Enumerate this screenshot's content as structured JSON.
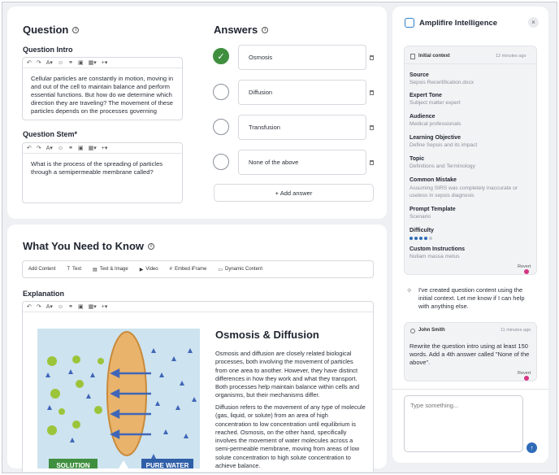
{
  "question": {
    "title": "Question",
    "intro_label": "Question Intro",
    "intro_text": "Cellular particles are constantly in motion, moving in and out of the cell to maintain balance and perform essential functions. But how do we determine which direction they are traveling? The movement of these particles depends on the processes governing",
    "stem_label": "Question Stem*",
    "stem_text": "What is the process of the spreading of particles through a semipermeable membrane called?"
  },
  "answers": {
    "title": "Answers",
    "items": [
      {
        "label": "Osmosis",
        "correct": true
      },
      {
        "label": "Diffusion",
        "correct": false
      },
      {
        "label": "Transfusion",
        "correct": false
      },
      {
        "label": "None of the above",
        "correct": false
      }
    ],
    "add_label": "+ Add answer"
  },
  "wytk": {
    "title": "What You Need to Know",
    "toolbar": [
      "Add Content",
      "Text",
      "Text & Image",
      "Video",
      "Embed iFrame",
      "Dynamic Content"
    ],
    "explanation_label": "Explanation",
    "heading": "Osmosis & Diffusion",
    "p1": "Osmosis and diffusion are closely related biological processes, both involving the movement of particles from one area to another. However, they have distinct differences in how they work and what they transport. Both processes help maintain balance within cells and organisms, but their mechanisms differ.",
    "p2": "Diffusion refers to the movement of any type of molecule (gas, liquid, or solute) from an area of high concentration to low concentration until equilibrium is reached. Osmosis, on the other hand, specifically involves the movement of water molecules across a semi-permeable membrane, moving from areas of low solute concentration to high solute concentration to achieve balance.",
    "img_left_label": "SOLUTION",
    "img_right_label": "PURE WATER"
  },
  "ai": {
    "title": "Amplifire Intelligence",
    "context_label": "Initial context",
    "context_time": "12 minutes ago",
    "fields": [
      {
        "k": "Source",
        "v": "Sepsis Recertification.docx"
      },
      {
        "k": "Expert Tone",
        "v": "Subject matter expert"
      },
      {
        "k": "Audience",
        "v": "Medical professionals"
      },
      {
        "k": "Learning Objective",
        "v": "Define Sepsis and its impact"
      },
      {
        "k": "Topic",
        "v": "Definitions and Terminology"
      },
      {
        "k": "Common Mistake",
        "v": "Assuming SIRS was completely inaccurate or useless in sepsis diagnosis"
      },
      {
        "k": "Prompt Template",
        "v": "Scenario"
      },
      {
        "k": "Difficulty",
        "v": ""
      },
      {
        "k": "Custom Instructions",
        "v": "Nullam massa metus"
      }
    ],
    "difficulty_level": 4,
    "revert_label": "Revert",
    "assistant_msg": "I've created question content using the initial context. Let me know if I can help with anything else.",
    "user_name": "John Smith",
    "user_time": "11 minutes ago",
    "user_msg": "Rewrite the question intro using at least 150 words. Add a 4th answer called \"None of the above\".",
    "input_placeholder": "Type something..."
  }
}
